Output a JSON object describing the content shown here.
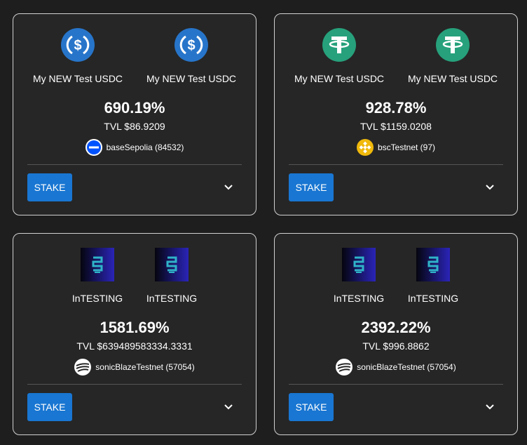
{
  "pools": [
    {
      "token_a": {
        "name": "My NEW Test USDC",
        "icon": "usdc-icon"
      },
      "token_b": {
        "name": "My NEW Test USDC",
        "icon": "usdc-icon"
      },
      "apr": "690.19%",
      "tvl": "TVL $86.9209",
      "network": {
        "label": "baseSepolia (84532)",
        "icon": "base-network-icon"
      },
      "stake_label": "STAKE",
      "expand_icon": "chevron-down-icon"
    },
    {
      "token_a": {
        "name": "My NEW Test USDC",
        "icon": "tether-icon"
      },
      "token_b": {
        "name": "My NEW Test USDC",
        "icon": "tether-icon"
      },
      "apr": "928.78%",
      "tvl": "TVL $1159.0208",
      "network": {
        "label": "bscTestnet (97)",
        "icon": "bnb-network-icon"
      },
      "stake_label": "STAKE",
      "expand_icon": "chevron-down-icon"
    },
    {
      "token_a": {
        "name": "InTESTING",
        "icon": "intesting-token-image"
      },
      "token_b": {
        "name": "InTESTING",
        "icon": "intesting-token-image"
      },
      "apr": "1581.69%",
      "tvl": "TVL $639489583334.3331",
      "network": {
        "label": "sonicBlazeTestnet (57054)",
        "icon": "sonic-network-icon"
      },
      "stake_label": "STAKE",
      "expand_icon": "chevron-down-icon"
    },
    {
      "token_a": {
        "name": "InTESTING",
        "icon": "intesting-token-image"
      },
      "token_b": {
        "name": "InTESTING",
        "icon": "intesting-token-image"
      },
      "apr": "2392.22%",
      "tvl": "TVL $996.8862",
      "network": {
        "label": "sonicBlazeTestnet (57054)",
        "icon": "sonic-network-icon"
      },
      "stake_label": "STAKE",
      "expand_icon": "chevron-down-icon"
    }
  ],
  "colors": {
    "background": "#1e1e1e",
    "card": "#262626",
    "card_border": "#d0d0d0",
    "stake_button": "#1976d2",
    "usdc_blue": "#2775ca",
    "tether_green": "#26a17b",
    "bnb_yellow": "#f0b90b",
    "base_blue": "#0052ff"
  }
}
